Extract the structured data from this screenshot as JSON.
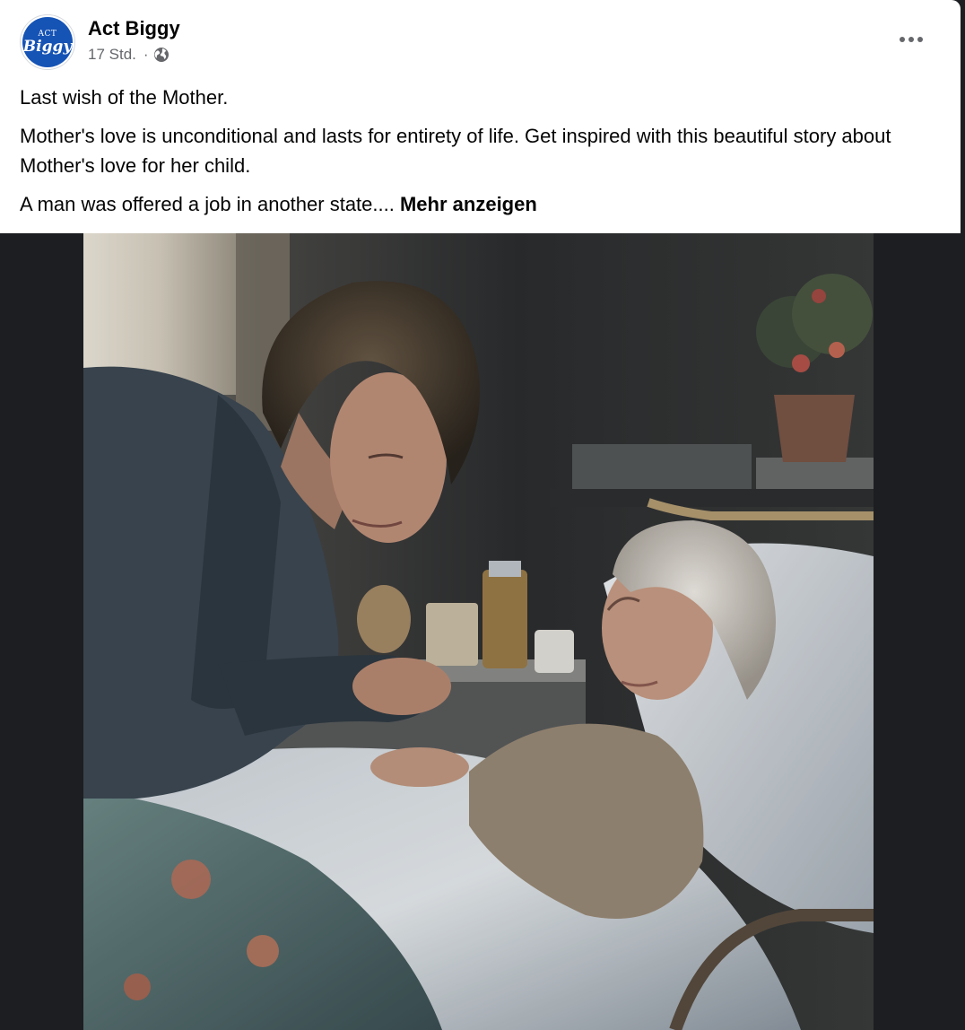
{
  "post": {
    "page_name": "Act Biggy",
    "avatar": {
      "top_text": "ACT",
      "main_text": "Biggy",
      "color": "#1553b5"
    },
    "timestamp": "17 Std.",
    "separator": "·",
    "audience_icon": "globe-icon",
    "more_icon": "more-horizontal-icon",
    "text": {
      "line1": "Last wish of the Mother.",
      "line2": "Mother's love is unconditional and lasts for entirety of life. Get inspired with this beautiful story about Mother's love for her child.",
      "line3": "A man was offered a job in another state....",
      "see_more": "Mehr anzeigen"
    },
    "image": {
      "subject": "painting-of-man-leaning-over-elderly-mother-in-hospital-bed"
    }
  },
  "colors": {
    "text_primary": "#050505",
    "text_secondary": "#65676b",
    "media_background": "#1c1e21"
  }
}
